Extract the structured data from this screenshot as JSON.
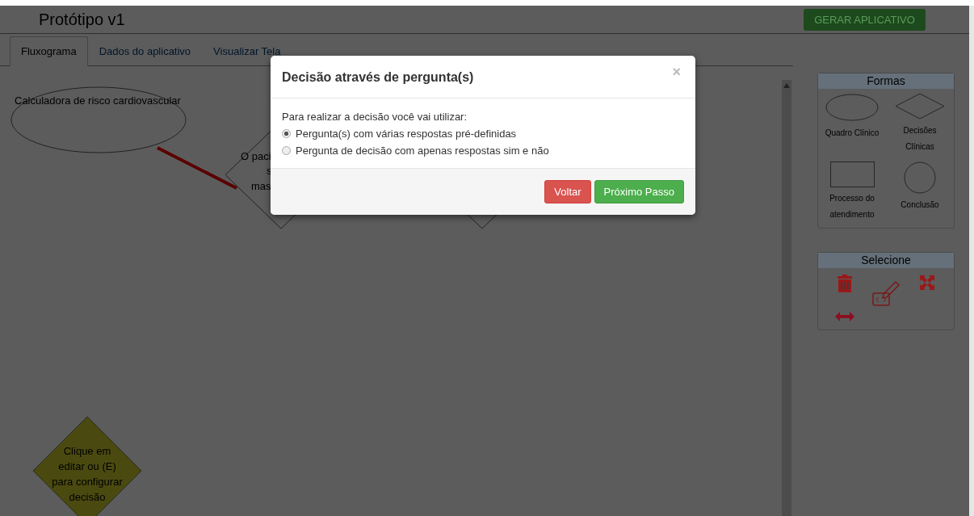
{
  "header": {
    "title": "Protótipo v1",
    "action": "GERAR APLICATIVO"
  },
  "tabs": [
    {
      "label": "Fluxograma",
      "selected": true
    },
    {
      "label": "Dados do aplicativo",
      "selected": false
    },
    {
      "label": "Visualizar Tela",
      "selected": false
    }
  ],
  "canvas": {
    "nodes": [
      {
        "kind": "ellipse",
        "lines": [
          "Calculadora de risco cardiovascular"
        ]
      },
      {
        "kind": "diamond",
        "lines": [
          "O paci",
          "s",
          "mas"
        ]
      },
      {
        "kind": "diamond"
      },
      {
        "kind": "pending",
        "lines": [
          "Clique em",
          "editar ou (E)",
          "para configurar",
          "decisão"
        ]
      }
    ]
  },
  "shapes_panel": {
    "title": "Formas",
    "items": [
      {
        "kind": "ellipse",
        "label": "Quadro Clínico"
      },
      {
        "kind": "diamond",
        "label": "Decisões Clínicas"
      },
      {
        "kind": "rect",
        "label": "Processo do atendimento"
      },
      {
        "kind": "circle",
        "label": "Conclusão"
      }
    ]
  },
  "select_panel": {
    "title": "Selecione"
  },
  "modal": {
    "title": "Decisão através de pergunta(s)",
    "close": "×",
    "prompt": "Para realizar a decisão você vai utilizar:",
    "options": [
      {
        "label": "Pergunta(s) com várias respostas pré-definidas",
        "selected": true
      },
      {
        "label": "Pergunta de decisão com apenas respostas sim e não",
        "selected": false
      }
    ],
    "buttons": [
      {
        "kind": "danger",
        "label": "Voltar"
      },
      {
        "kind": "success",
        "label": "Próximo Passo"
      }
    ]
  }
}
